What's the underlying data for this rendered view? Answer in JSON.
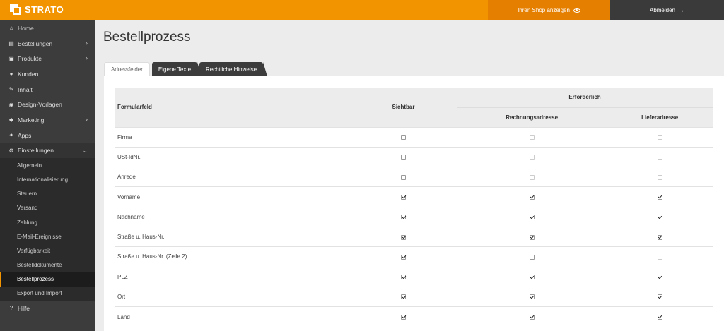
{
  "header": {
    "logo_text": "STRATO",
    "shop_label": "Ihren Shop anzeigen",
    "logout_label": "Abmelden"
  },
  "sidebar": {
    "items": [
      {
        "label": "Home",
        "icon": "home-icon",
        "chevron": false
      },
      {
        "label": "Bestellungen",
        "icon": "orders-icon",
        "chevron": true
      },
      {
        "label": "Produkte",
        "icon": "cart-icon",
        "chevron": true
      },
      {
        "label": "Kunden",
        "icon": "user-icon",
        "chevron": false
      },
      {
        "label": "Inhalt",
        "icon": "pencil-icon",
        "chevron": false
      },
      {
        "label": "Design-Vorlagen",
        "icon": "palette-icon",
        "chevron": false
      },
      {
        "label": "Marketing",
        "icon": "tag-icon",
        "chevron": true
      },
      {
        "label": "Apps",
        "icon": "puzzle-icon",
        "chevron": false
      },
      {
        "label": "Einstellungen",
        "icon": "gear-icon",
        "chevron": true
      }
    ],
    "sub_items": [
      {
        "label": "Allgemein",
        "active": false
      },
      {
        "label": "Internationalisierung",
        "active": false
      },
      {
        "label": "Steuern",
        "active": false
      },
      {
        "label": "Versand",
        "active": false
      },
      {
        "label": "Zahlung",
        "active": false
      },
      {
        "label": "E-Mail-Ereignisse",
        "active": false
      },
      {
        "label": "Verfügbarkeit",
        "active": false
      },
      {
        "label": "Bestelldokumente",
        "active": false
      },
      {
        "label": "Bestellprozess",
        "active": true
      },
      {
        "label": "Export und Import",
        "active": false
      }
    ],
    "help": {
      "label": "Hilfe",
      "icon": "question-icon"
    }
  },
  "main": {
    "title": "Bestellprozess",
    "tabs": [
      {
        "label": "Adressfelder",
        "active": true
      },
      {
        "label": "Eigene Texte",
        "active": false
      },
      {
        "label": "Rechtliche Hinweise",
        "active": false
      }
    ],
    "table": {
      "col_formfield": "Formularfeld",
      "col_visible": "Sichtbar",
      "col_required": "Erforderlich",
      "col_billing": "Rechnungsadresse",
      "col_delivery": "Lieferadresse",
      "rows": [
        {
          "label": "Firma",
          "visible": false,
          "billing": false,
          "delivery": false,
          "billing_disabled": true,
          "delivery_disabled": true
        },
        {
          "label": "USt-IdNr.",
          "visible": false,
          "billing": false,
          "delivery": false,
          "billing_disabled": true,
          "delivery_disabled": true
        },
        {
          "label": "Anrede",
          "visible": false,
          "billing": false,
          "delivery": false,
          "billing_disabled": true,
          "delivery_disabled": true
        },
        {
          "label": "Vorname",
          "visible": true,
          "billing": true,
          "delivery": true,
          "billing_disabled": false,
          "delivery_disabled": false
        },
        {
          "label": "Nachname",
          "visible": true,
          "billing": true,
          "delivery": true,
          "billing_disabled": false,
          "delivery_disabled": false
        },
        {
          "label": "Straße u. Haus-Nr.",
          "visible": true,
          "billing": true,
          "delivery": true,
          "billing_disabled": false,
          "delivery_disabled": false
        },
        {
          "label": "Straße u. Haus-Nr. (Zeile 2)",
          "visible": true,
          "billing": false,
          "delivery": false,
          "billing_disabled": false,
          "delivery_disabled": true
        },
        {
          "label": "PLZ",
          "visible": true,
          "billing": true,
          "delivery": true,
          "billing_disabled": false,
          "delivery_disabled": false
        },
        {
          "label": "Ort",
          "visible": true,
          "billing": true,
          "delivery": true,
          "billing_disabled": false,
          "delivery_disabled": false
        },
        {
          "label": "Land",
          "visible": true,
          "billing": true,
          "delivery": true,
          "billing_disabled": false,
          "delivery_disabled": false
        }
      ]
    }
  },
  "colors": {
    "accent": "#f29400",
    "sidebar": "#3c3c3c"
  }
}
